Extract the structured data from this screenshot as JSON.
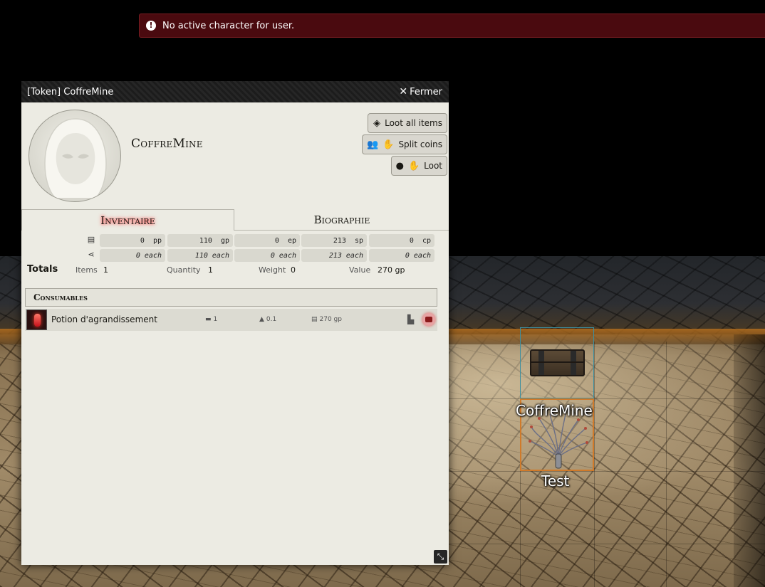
{
  "notification": {
    "text": "No active character for user.",
    "icon": "exclamation-circle-icon"
  },
  "sheet": {
    "title": "[Token] CoffreMine",
    "close_label": "Fermer",
    "actor_name": "CoffreMine",
    "actions": {
      "loot_all": "Loot all items",
      "split_coins": "Split coins",
      "loot": "Loot"
    },
    "tabs": {
      "inventory": "Inventaire",
      "biography": "Biographie"
    },
    "currency": [
      {
        "amount": "0",
        "unit": "pp",
        "each": "0 each"
      },
      {
        "amount": "110",
        "unit": "gp",
        "each": "110 each"
      },
      {
        "amount": "0",
        "unit": "ep",
        "each": "0 each"
      },
      {
        "amount": "213",
        "unit": "sp",
        "each": "213 each"
      },
      {
        "amount": "0",
        "unit": "cp",
        "each": "0 each"
      }
    ],
    "totals": {
      "label": "Totals",
      "items_label": "Items",
      "items_value": "1",
      "quantity_label": "Quantity",
      "quantity_value": "1",
      "weight_label": "Weight",
      "weight_value": "0",
      "value_label": "Value",
      "value_value": "270 gp"
    },
    "group_header": "Consumables",
    "items": [
      {
        "name": "Potion d'agrandissement",
        "quantity": "1",
        "weight": "0.1",
        "price": "270 gp"
      }
    ]
  },
  "tokens": {
    "chest_label": "CoffreMine",
    "test_label": "Test"
  },
  "colors": {
    "notification_bg": "#4a0a0f",
    "sheet_bg": "#ecebe3",
    "header_bg": "#1c1c1c",
    "tab_glow": "#ff4040",
    "token_selected_border": "#d07a2a",
    "token_border": "#3c8fa0"
  }
}
